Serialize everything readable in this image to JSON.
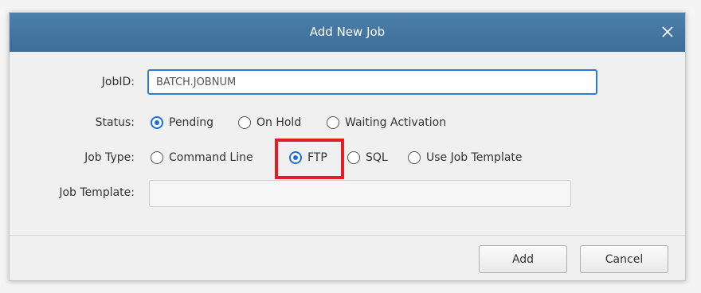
{
  "dialog": {
    "title": "Add New Job",
    "close_icon": "close-icon"
  },
  "form": {
    "jobid": {
      "label": "JobID:",
      "value": "BATCH.JOBNUM"
    },
    "status": {
      "label": "Status:",
      "options": [
        {
          "label": "Pending",
          "checked": true
        },
        {
          "label": "On Hold",
          "checked": false
        },
        {
          "label": "Waiting Activation",
          "checked": false
        }
      ]
    },
    "job_type": {
      "label": "Job Type:",
      "options": [
        {
          "label": "Command Line",
          "checked": false
        },
        {
          "label": "FTP",
          "checked": true
        },
        {
          "label": "SQL",
          "checked": false
        },
        {
          "label": "Use Job Template",
          "checked": false
        }
      ]
    },
    "job_template": {
      "label": "Job Template:",
      "value": ""
    }
  },
  "buttons": {
    "add": "Add",
    "cancel": "Cancel"
  },
  "colors": {
    "titlebar": "#4577a4",
    "accent": "#1e6fd9",
    "highlight": "#e21d26"
  }
}
